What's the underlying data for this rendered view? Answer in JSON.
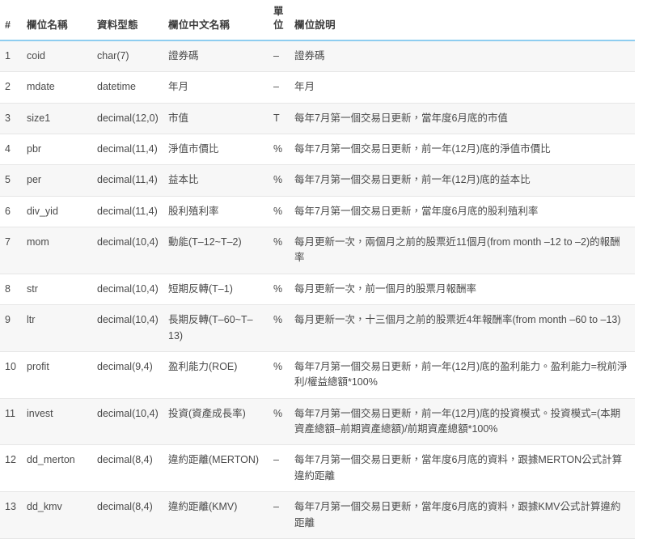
{
  "table": {
    "columns": [
      {
        "key": "num",
        "label": "#"
      },
      {
        "key": "name",
        "label": "欄位名稱"
      },
      {
        "key": "type",
        "label": "資料型態"
      },
      {
        "key": "cname",
        "label": "欄位中文名稱"
      },
      {
        "key": "unit",
        "label": "單位"
      },
      {
        "key": "desc",
        "label": "欄位說明"
      }
    ],
    "header_border_color": "#8ecdf0",
    "stripe_color": "#f7f7f7",
    "row_border_color": "#e6e6e6",
    "text_color": "#4a4a4a",
    "rows": [
      {
        "num": "1",
        "name": "coid",
        "type": "char(7)",
        "cname": "證券碼",
        "unit": "–",
        "desc": "證券碼"
      },
      {
        "num": "2",
        "name": "mdate",
        "type": "datetime",
        "cname": "年月",
        "unit": "–",
        "desc": "年月"
      },
      {
        "num": "3",
        "name": "size1",
        "type": "decimal(12,0)",
        "cname": "市值",
        "unit": "T",
        "desc": "每年7月第一個交易日更新，當年度6月底的市值"
      },
      {
        "num": "4",
        "name": "pbr",
        "type": "decimal(11,4)",
        "cname": "淨值市價比",
        "unit": "%",
        "desc": "每年7月第一個交易日更新，前一年(12月)底的淨值市價比"
      },
      {
        "num": "5",
        "name": "per",
        "type": "decimal(11,4)",
        "cname": "益本比",
        "unit": "%",
        "desc": "每年7月第一個交易日更新，前一年(12月)底的益本比"
      },
      {
        "num": "6",
        "name": "div_yid",
        "type": "decimal(11,4)",
        "cname": "股利殖利率",
        "unit": "%",
        "desc": "每年7月第一個交易日更新，當年度6月底的股利殖利率"
      },
      {
        "num": "7",
        "name": "mom",
        "type": "decimal(10,4)",
        "cname": "動能(T–12~T–2)",
        "unit": "%",
        "desc": "每月更新一次，兩個月之前的股票近11個月(from month –12 to –2)的報酬率"
      },
      {
        "num": "8",
        "name": "str",
        "type": "decimal(10,4)",
        "cname": "短期反轉(T–1)",
        "unit": "%",
        "desc": "每月更新一次，前一個月的股票月報酬率"
      },
      {
        "num": "9",
        "name": "ltr",
        "type": "decimal(10,4)",
        "cname": "長期反轉(T–60~T–13)",
        "unit": "%",
        "desc": "每月更新一次，十三個月之前的股票近4年報酬率(from month –60 to –13)"
      },
      {
        "num": "10",
        "name": "profit",
        "type": "decimal(9,4)",
        "cname": "盈利能力(ROE)",
        "unit": "%",
        "desc": "每年7月第一個交易日更新，前一年(12月)底的盈利能力。盈利能力=稅前淨利/權益總額*100%"
      },
      {
        "num": "11",
        "name": "invest",
        "type": "decimal(10,4)",
        "cname": "投資(資產成長率)",
        "unit": "%",
        "desc": "每年7月第一個交易日更新，前一年(12月)底的投資模式。投資模式=(本期資產總額–前期資產總額)/前期資產總額*100%"
      },
      {
        "num": "12",
        "name": "dd_merton",
        "type": "decimal(8,4)",
        "cname": "違約距離(MERTON)",
        "unit": "–",
        "desc": "每年7月第一個交易日更新，當年度6月底的資料，跟據MERTON公式計算違約距離"
      },
      {
        "num": "13",
        "name": "dd_kmv",
        "type": "decimal(8,4)",
        "cname": "違約距離(KMV)",
        "unit": "–",
        "desc": "每年7月第一個交易日更新，當年度6月底的資料，跟據KMV公式計算違約距離"
      }
    ]
  }
}
